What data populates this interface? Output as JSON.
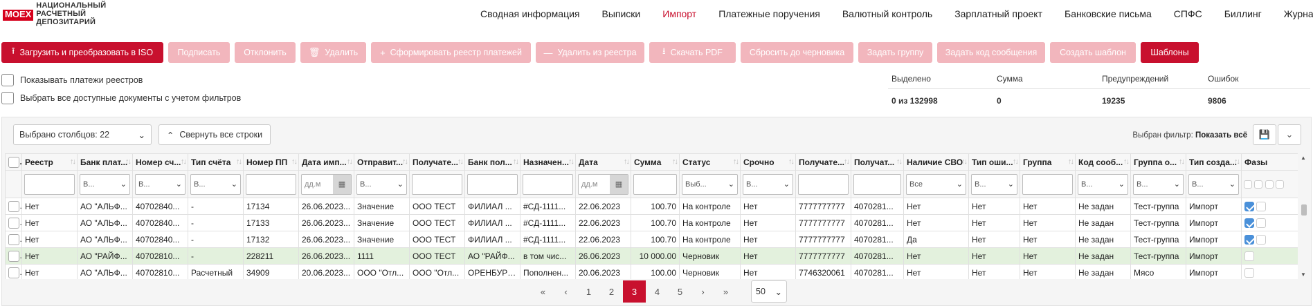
{
  "brand": {
    "logo_mark": "MOEX",
    "logo_line1": "НАЦИОНАЛЬНЫЙ",
    "logo_line2": "РАСЧЕТНЫЙ",
    "logo_line3": "ДЕПОЗИТАРИЙ"
  },
  "nav": {
    "items": [
      "Сводная информация",
      "Выписки",
      "Импорт",
      "Платежные поручения",
      "Валютный контроль",
      "Зарплатный проект",
      "Банковские письма",
      "СПФС",
      "Биллинг",
      "Журнал"
    ],
    "active": "Импорт"
  },
  "toolbar": {
    "upload": "Загрузить и преобразовать в ISO",
    "sign": "Подписать",
    "reject": "Отклонить",
    "delete": "Удалить",
    "form_registry": "Сформировать реестр платежей",
    "remove_registry": "Удалить из реестра",
    "download_pdf": "Скачать PDF",
    "reset_draft": "Сбросить до черновика",
    "set_group": "Задать группу",
    "set_msg_code": "Задать код сообщения",
    "create_template": "Создать шаблон",
    "templates": "Шаблоны"
  },
  "options": {
    "show_registry_payments": "Показывать платежи реестров",
    "select_all_filtered": "Выбрать все доступные документы с учетом фильтров"
  },
  "summary": {
    "headers": [
      "Выделено",
      "Сумма",
      "Предупреждений",
      "Ошибок"
    ],
    "values": [
      "0 из 132998",
      "0",
      "19235",
      "9806"
    ]
  },
  "grid": {
    "columns_selected": "Выбрано столбцов: 22",
    "collapse_rows": "Свернуть все строки",
    "filter_label": "Выбран фильтр:",
    "filter_value": "Показать всё"
  },
  "table": {
    "headers": [
      "Реестр",
      "Банк плат...",
      "Номер сч...",
      "Тип счёта",
      "Номер ПП",
      "Дата имп...",
      "Отправит...",
      "Получате...",
      "Банк пол...",
      "Назначен...",
      "Дата",
      "Сумма",
      "Статус",
      "Срочно",
      "Получате...",
      "Получат...",
      "Наличие СВО",
      "Тип оши...",
      "Группа",
      "Код сооб...",
      "Группа о...",
      "Тип созда...",
      "Фазы"
    ],
    "filters": [
      "",
      "В...",
      "В...",
      "В...",
      "",
      "дд.м",
      "В...",
      "",
      "",
      "",
      "дд.м",
      "",
      "Выб...",
      "В...",
      "",
      "",
      "Все",
      "В...",
      "",
      "В...",
      "В...",
      "В...",
      ""
    ],
    "rows": [
      [
        "Нет",
        "АО \"АЛЬФ...",
        "40702840...",
        "-",
        "17134",
        "26.06.2023...",
        "Значение",
        "ООО ТЕСТ",
        "ФИЛИАЛ ...",
        "#СД-1111...",
        "22.06.2023",
        "100.70",
        "На контроле",
        "Нет",
        "7777777777",
        "4070281...",
        "Нет",
        "Нет",
        "Нет",
        "Не задан",
        "Тест-группа",
        "Импорт"
      ],
      [
        "Нет",
        "АО \"АЛЬФ...",
        "40702840...",
        "-",
        "17133",
        "26.06.2023...",
        "Значение",
        "ООО ТЕСТ",
        "ФИЛИАЛ ...",
        "#СД-1111...",
        "22.06.2023",
        "100.70",
        "На контроле",
        "Нет",
        "7777777777",
        "4070281...",
        "Нет",
        "Нет",
        "Нет",
        "Не задан",
        "Тест-группа",
        "Импорт"
      ],
      [
        "Нет",
        "АО \"АЛЬФ...",
        "40702840...",
        "-",
        "17132",
        "26.06.2023...",
        "Значение",
        "ООО ТЕСТ",
        "ФИЛИАЛ ...",
        "#СД-1111...",
        "22.06.2023",
        "100.70",
        "На контроле",
        "Нет",
        "7777777777",
        "4070281...",
        "Да",
        "Нет",
        "Нет",
        "Не задан",
        "Тест-группа",
        "Импорт"
      ],
      [
        "Нет",
        "АО \"РАЙФ...",
        "40702810...",
        "-",
        "228211",
        "26.06.2023...",
        "1111",
        "ООО ТЕСТ",
        "АО \"РАЙФ...",
        "в том чис...",
        "26.06.2023",
        "10 000.00",
        "Черновик",
        "Нет",
        "7777777777",
        "4070281...",
        "Нет",
        "Нет",
        "Нет",
        "Не задан",
        "Тест-группа",
        "Импорт"
      ],
      [
        "Нет",
        "АО \"АЛЬФ...",
        "40702810...",
        "Расчетный",
        "34909",
        "20.06.2023...",
        "ООО \"Отл...",
        "ООО \"Отл...",
        "ОРЕНБУРГ...",
        "Пополнен...",
        "20.06.2023",
        "100.00",
        "Черновик",
        "Нет",
        "7746320061",
        "4070281...",
        "Нет",
        "Нет",
        "Нет",
        "Не задан",
        "Мясо",
        "Импорт"
      ]
    ]
  },
  "pager": {
    "first": "«",
    "prev": "‹",
    "pages": [
      "1",
      "2",
      "3",
      "4",
      "5"
    ],
    "current": "3",
    "next": "›",
    "last": "»",
    "page_size": "50"
  },
  "colors": {
    "accent": "#c8102e",
    "accent_disabled": "#f2b6bd",
    "row_highlight": "#e3f1dd",
    "check": "#4a90d9"
  }
}
